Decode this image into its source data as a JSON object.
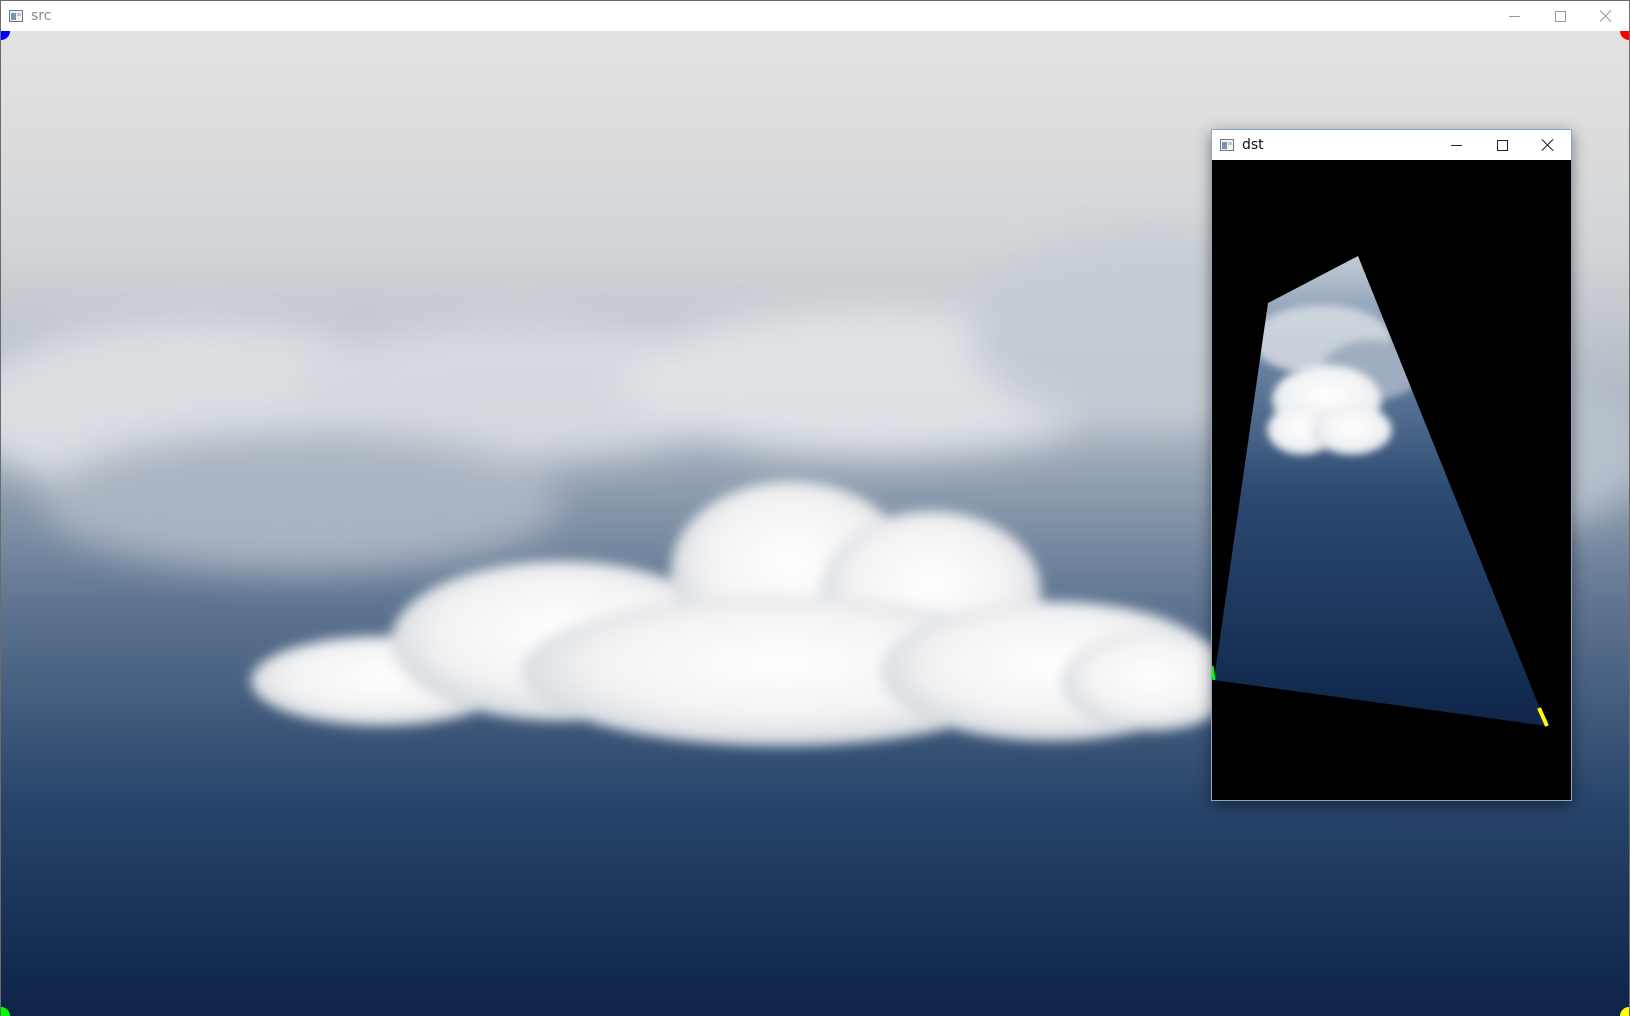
{
  "src_window": {
    "title": "src",
    "icon": "window-app-icon",
    "controls": [
      "minimize-icon",
      "maximize-icon",
      "close-icon"
    ]
  },
  "dst_window": {
    "title": "dst",
    "icon": "window-app-icon",
    "controls": [
      "minimize-icon",
      "maximize-icon",
      "close-icon"
    ]
  },
  "colors": {
    "corner_marker_top_left": "#0000ff",
    "corner_marker_top_right": "#ff0000",
    "corner_marker_bottom_left": "#00ff00",
    "corner_marker_bottom_right": "#ffff00",
    "sky_top": "#e6e6e6",
    "sky_bottom": "#0f2749",
    "dst_background": "#000000"
  }
}
